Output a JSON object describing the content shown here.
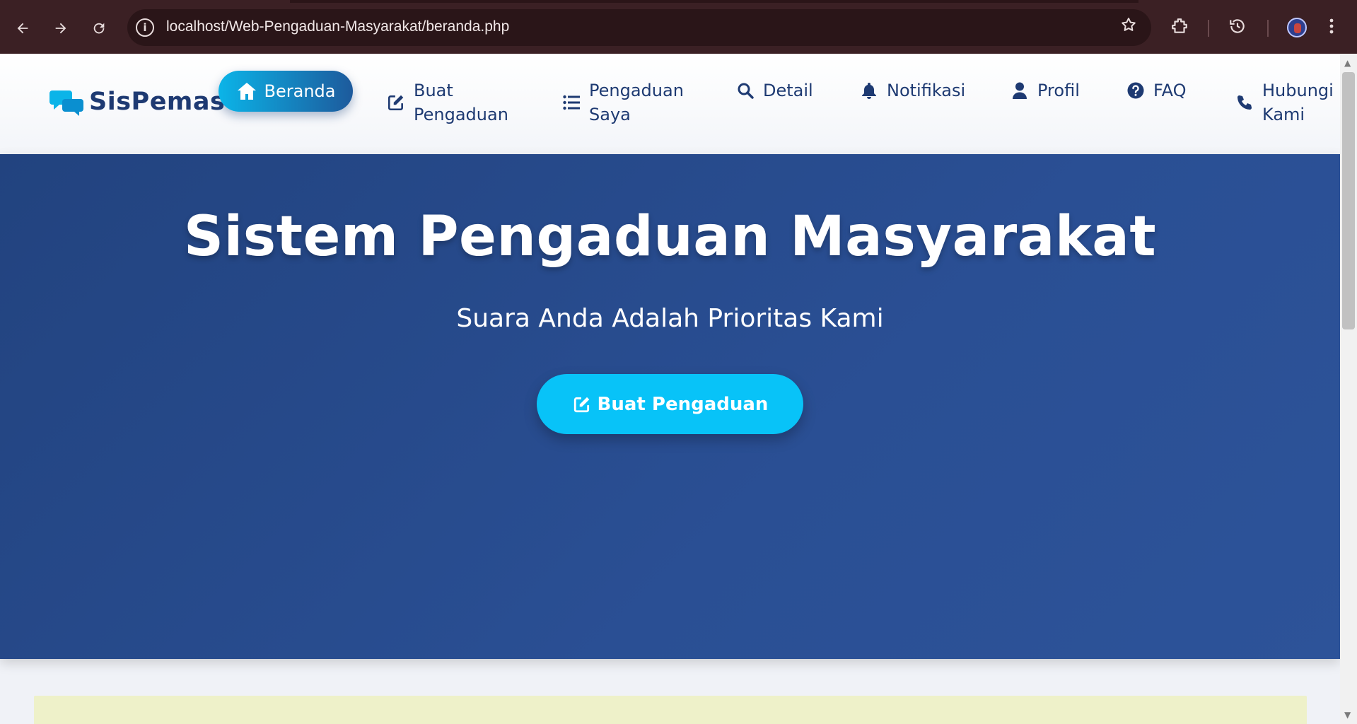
{
  "browser": {
    "url": "localhost/Web-Pengaduan-Masyarakat/beranda.php",
    "icons": {
      "back": "arrow-left-icon",
      "forward": "arrow-right-icon",
      "reload": "reload-icon",
      "site_info": "info-icon",
      "bookmark": "star-icon",
      "extensions": "puzzle-icon",
      "history": "history-icon",
      "profile": "avatar",
      "menu": "kebab-menu-icon"
    }
  },
  "navbar": {
    "brand": "SisPemas",
    "brand_icon": "comments-icon",
    "active_item": {
      "label": "Beranda",
      "icon": "home-icon"
    },
    "items": [
      {
        "label_line1": "Buat",
        "label_line2": "Pengaduan",
        "icon": "edit-icon"
      },
      {
        "label_line1": "Pengaduan",
        "label_line2": "Saya",
        "icon": "list-icon"
      },
      {
        "label": "Detail",
        "icon": "search-icon"
      },
      {
        "label": "Notifikasi",
        "icon": "bell-icon"
      },
      {
        "label": "Profil",
        "icon": "user-icon"
      },
      {
        "label": "FAQ",
        "icon": "question-circle-icon"
      },
      {
        "label_line1": "Hubungi",
        "label_line2": "Kami",
        "icon": "phone-icon"
      }
    ]
  },
  "hero": {
    "title": "Sistem Pengaduan Masyarakat",
    "subtitle": "Suara Anda Adalah Prioritas Kami",
    "cta_label": "Buat Pengaduan",
    "cta_icon": "edit-icon"
  },
  "colors": {
    "brand_navy": "#1e3a72",
    "accent_cyan": "#08c3f8",
    "hero_bg": "#2a4f94",
    "chrome_bg": "#3b2024",
    "notice_bg": "#eef1c9"
  }
}
